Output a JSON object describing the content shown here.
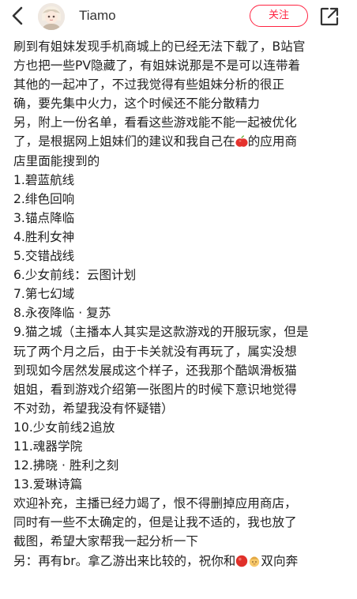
{
  "header": {
    "username": "Tiamo",
    "follow_label": "关注"
  },
  "post": {
    "lines": [
      "刷到有姐妹发现手机商城上的已经无法下载了，B站官",
      "方也把一些PV隐藏了，有姐妹说那是不是可以连带着",
      "其他的一起冲了，不过我觉得有些姐妹分析的很正",
      "确，要先集中火力，这个时候还不能分散精力",
      "另，附上一份名单，看看这些游戏能不能一起被优化",
      [
        "了，是根据网上姐妹们的建议和我自己在",
        "的应用商"
      ],
      "店里面能搜到的",
      "1.碧蓝航线",
      "2.绯色回响",
      "3.锚点降临",
      "4.胜利女神",
      "5.交错战线",
      "6.少女前线：云图计划",
      "7.第七幻域",
      "8.永夜降临 · 复苏",
      "9.猫之城（主播本人其实是这款游戏的开服玩家，但是",
      "玩了两个月之后，由于卡关就没有再玩了，属实没想",
      "到现如今居然发展成这个样子，还我那个酷飒滑板猫",
      "姐姐，看到游戏介绍第一张图片的时候下意识地觉得",
      "不对劲，希望我没有怀疑错）",
      "10.少女前线2追放",
      "11.魂器学院",
      "12.拂晓 · 胜利之刻",
      "13.爱琳诗篇",
      "欢迎补充，主播已经力竭了，恨不得删掉应用商店，",
      "同时有一些不太确定的，但是让我不适的，我也放了",
      "截图，希望大家帮我一起分析一下",
      [
        "另：再有br。拿乙游出来比较的，祝你和",
        "双向奔"
      ]
    ],
    "icons": {
      "apple": "apple-emoji",
      "red_circle": "red-circle-emoji",
      "baby": "baby-emoji"
    }
  }
}
